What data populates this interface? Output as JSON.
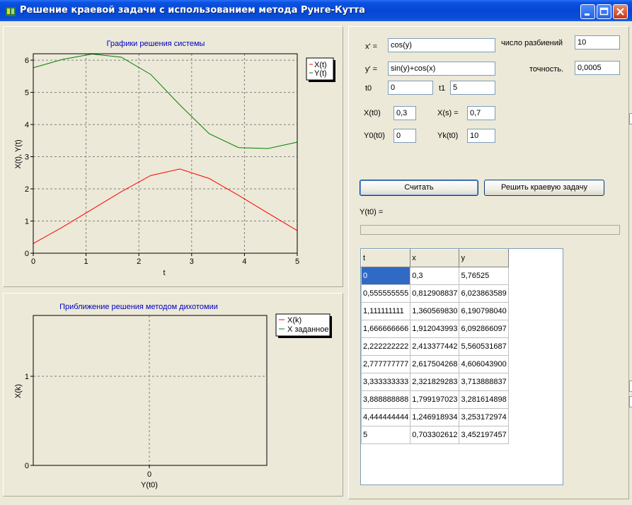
{
  "window": {
    "title": "Решение краевой задачи с использованием метода Рунге-Кутта",
    "icon": "app-icon",
    "controls": [
      "minimize-icon",
      "maximize-icon",
      "close-icon"
    ]
  },
  "chart1": {
    "title": "Графики решения системы",
    "xlabel": "t",
    "ylabel": "X(t), Y(t)",
    "legend": [
      "X(t)",
      "Y(t)"
    ]
  },
  "chart2": {
    "title": "Приближение решения методом дихотомии",
    "xlabel": "Y(t0)",
    "ylabel": "X(k)",
    "legend": [
      "X(k)",
      "X заданное"
    ]
  },
  "chart_data": [
    {
      "type": "line",
      "title": "Графики решения системы",
      "xlabel": "t",
      "ylabel": "X(t), Y(t)",
      "xlim": [
        0,
        5
      ],
      "ylim": [
        0,
        6.2
      ],
      "xticks": [
        "0",
        "1",
        "2",
        "3",
        "4",
        "5"
      ],
      "yticks": [
        "0",
        "1",
        "2",
        "3",
        "4",
        "5",
        "6"
      ],
      "grid": true,
      "legend_position": "top-right",
      "x": [
        0,
        0.5555555556,
        1.1111111111,
        1.6666666667,
        2.2222222222,
        2.7777777778,
        3.3333333333,
        3.8888888889,
        4.4444444444,
        5
      ],
      "series": [
        {
          "name": "X(t)",
          "color": "#ff0000",
          "values": [
            0.3,
            0.8129088,
            1.3605698,
            1.9120439,
            2.4133774,
            2.6175043,
            2.3218293,
            1.799197,
            1.2469189,
            0.7033026
          ]
        },
        {
          "name": "Y(t)",
          "color": "#008000",
          "values": [
            5.76525,
            6.0238636,
            6.190798,
            6.0928661,
            5.5605317,
            4.6060439,
            3.7138888,
            3.2816149,
            3.253173,
            3.4521975
          ]
        }
      ]
    },
    {
      "type": "line",
      "title": "Приближение решения методом дихотомии",
      "xlabel": "Y(t0)",
      "ylabel": "X(k)",
      "xticks": [
        "0"
      ],
      "yticks": [
        "0",
        "1"
      ],
      "grid": true,
      "legend_position": "top-right",
      "series": [
        {
          "name": "X(k)",
          "color": "#ff0000",
          "values": []
        },
        {
          "name": "X заданное",
          "color": "#008000",
          "values": []
        }
      ]
    }
  ],
  "form": {
    "xprime_label": "x' =",
    "xprime_value": "cos(y)",
    "yprime_label": "y' =",
    "yprime_value": "sin(y)+cos(x)",
    "t0_label": "t0",
    "t0_value": "0",
    "t1_label": "t1",
    "t1_value": "5",
    "splits_label": "число разбиений",
    "splits_value": "10",
    "accuracy_label": "точность.",
    "accuracy_value": "0,0005",
    "xt0_label": "X(t0)",
    "xt0_value": "0,3",
    "xs_label": "X(s) =",
    "xs_value": "0,7",
    "y0t0_label": "Y0(t0)",
    "y0t0_value": "0",
    "ykt0_label": "Yk(t0)",
    "ykt0_value": "10",
    "calc_button": "Считать",
    "solve_button": "Решить краевую задачу",
    "result_label": "Y(t0) ="
  },
  "table": {
    "columns": [
      "t",
      "x",
      "y"
    ],
    "rows": [
      [
        "0",
        "0,3",
        "5,76525"
      ],
      [
        "0,555555555",
        "0,812908837",
        "6,023863589"
      ],
      [
        "1,111111111",
        "1,360569830",
        "6,190798040"
      ],
      [
        "1,666666666",
        "1,912043993",
        "6,092866097"
      ],
      [
        "2,222222222",
        "2,413377442",
        "5,560531687"
      ],
      [
        "2,777777777",
        "2,617504268",
        "4,606043900"
      ],
      [
        "3,333333333",
        "2,321829283",
        "3,713888837"
      ],
      [
        "3,888888888",
        "1,799197023",
        "3,281614898"
      ],
      [
        "4,444444444",
        "1,246918934",
        "3,253172974"
      ],
      [
        "5",
        "0,703302612",
        "3,452197457"
      ]
    ]
  }
}
